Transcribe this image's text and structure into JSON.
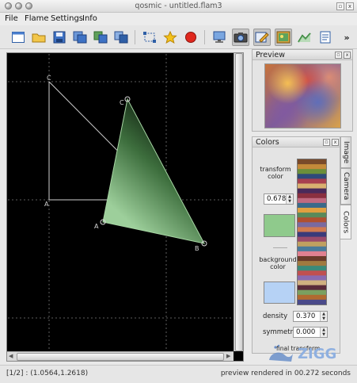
{
  "window": {
    "title": "qosmic - untitled.flam3"
  },
  "menu": [
    "File",
    "Flame",
    "Settings",
    "Info"
  ],
  "toolbar": {
    "icons": [
      "new-file-icon",
      "open-folder-icon",
      "save-icon",
      "save-as-icon",
      "export-icon",
      "import-icon",
      "select-triangles-icon",
      "favorite-star-icon",
      "stop-render-icon",
      "monitor-icon",
      "camera-icon",
      "edit-icon",
      "image-icon",
      "chart-icon",
      "script-icon",
      "more-icon"
    ],
    "more": "»"
  },
  "canvas": {
    "base_labels": {
      "c": "C",
      "a": "A",
      "b": "B"
    },
    "transform_labels": {
      "c": "C",
      "a": "A",
      "b": "B"
    }
  },
  "preview": {
    "title": "Preview"
  },
  "colors": {
    "title": "Colors",
    "transform_label": "transform color",
    "transform_value": "0.678",
    "transform_swatch": "#8fca8c",
    "background_label": "background color",
    "background_swatch": "#b6d2f5",
    "density_label": "density",
    "density_value": "0.370",
    "symmetry_label": "symmetry",
    "symmetry_value": "0.000",
    "final_transform_label": "final transform"
  },
  "tabs": [
    "Image",
    "Camera",
    "Colors"
  ],
  "dock_buttons": {
    "float": "▫",
    "close": "x"
  },
  "status": {
    "coords": "[1/2] : (1.0564,1.2618)",
    "render": "preview rendered in 00.272 seconds"
  },
  "watermark": {
    "text": "ZIGG"
  }
}
